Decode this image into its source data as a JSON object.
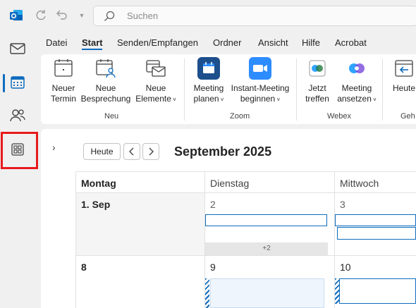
{
  "search": {
    "placeholder": "Suchen"
  },
  "menu": {
    "tabs": [
      "Datei",
      "Start",
      "Senden/Empfangen",
      "Ordner",
      "Ansicht",
      "Hilfe",
      "Acrobat"
    ],
    "active": "Start"
  },
  "ribbon": {
    "groups": {
      "neu": "Neu",
      "zoom": "Zoom",
      "webex": "Webex",
      "gehe": "Geh"
    },
    "buttons": {
      "neuer_termin_1": "Neuer",
      "neuer_termin_2": "Termin",
      "neue_besprechung_1": "Neue",
      "neue_besprechung_2": "Besprechung",
      "neue_elemente_1": "Neue",
      "neue_elemente_2": "Elemente",
      "meeting_planen_1": "Meeting",
      "meeting_planen_2": "planen",
      "instant_meeting_1": "Instant-Meeting",
      "instant_meeting_2": "beginnen",
      "jetzt_treffen_1": "Jetzt",
      "jetzt_treffen_2": "treffen",
      "meeting_ansetzen_1": "Meeting",
      "meeting_ansetzen_2": "ansetzen",
      "heute": "Heute"
    }
  },
  "nav": {
    "today_button": "Heute",
    "month_title": "September 2025"
  },
  "calendar": {
    "days": [
      "Montag",
      "Dienstag",
      "Mittwoch"
    ],
    "week1": {
      "mon": "1. Sep",
      "tue": "2",
      "wed": "3",
      "more": "+2"
    },
    "week2": {
      "mon": "8",
      "tue": "9",
      "wed": "10"
    }
  },
  "colors": {
    "accent": "#0f6cbd",
    "highlight": "#e8191d",
    "zoom": "#2d8cff",
    "planner": "#1c4f8c"
  }
}
